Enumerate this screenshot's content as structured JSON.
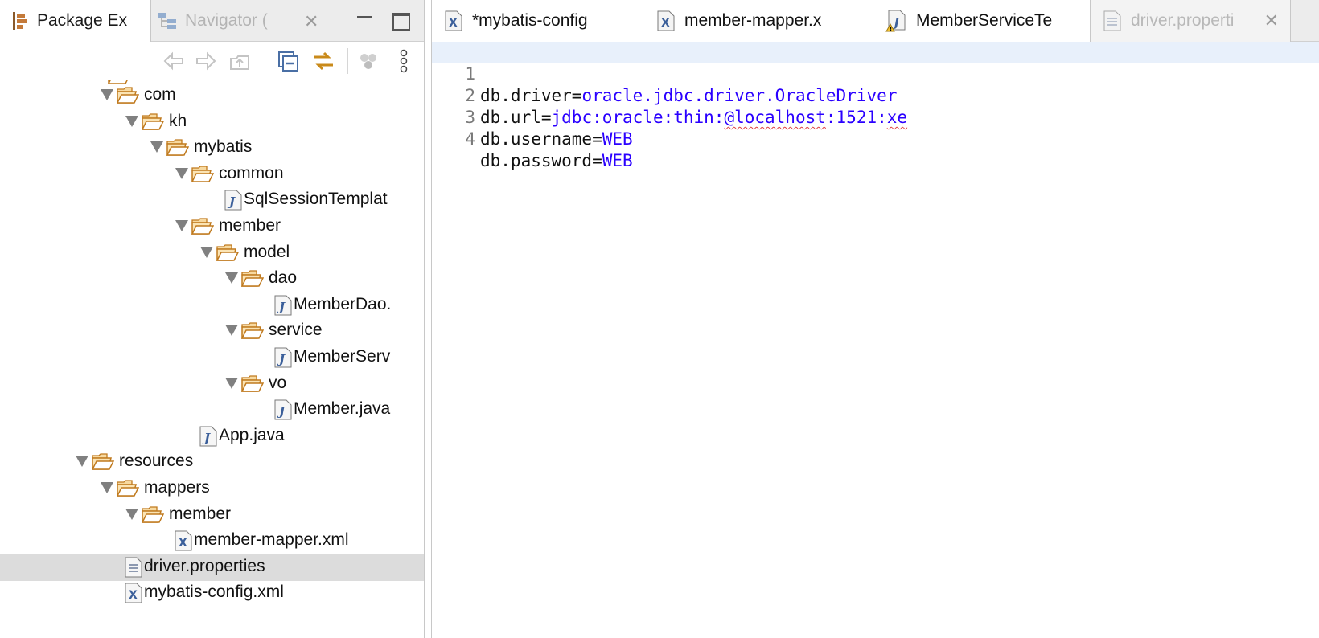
{
  "left_panel": {
    "tabs": [
      {
        "label": "Package Ex",
        "icon": "package-explorer-icon",
        "active": true
      },
      {
        "label": "Navigator (",
        "icon": "navigator-icon",
        "active": false
      }
    ],
    "tree": [
      {
        "label": "com",
        "type": "folder",
        "depth": 1,
        "expanded": true
      },
      {
        "label": "kh",
        "type": "folder",
        "depth": 2,
        "expanded": true
      },
      {
        "label": "mybatis",
        "type": "folder",
        "depth": 3,
        "expanded": true
      },
      {
        "label": "common",
        "type": "folder",
        "depth": 4,
        "expanded": true
      },
      {
        "label": "SqlSessionTemplat",
        "type": "java",
        "depth": 5
      },
      {
        "label": "member",
        "type": "folder",
        "depth": 4,
        "expanded": true
      },
      {
        "label": "model",
        "type": "folder",
        "depth": 5,
        "expanded": true
      },
      {
        "label": "dao",
        "type": "folder",
        "depth": 6,
        "expanded": true
      },
      {
        "label": "MemberDao.",
        "type": "java",
        "depth": 7
      },
      {
        "label": "service",
        "type": "folder",
        "depth": 6,
        "expanded": true
      },
      {
        "label": "MemberServ",
        "type": "java",
        "depth": 7
      },
      {
        "label": "vo",
        "type": "folder",
        "depth": 6,
        "expanded": true
      },
      {
        "label": "Member.java",
        "type": "java",
        "depth": 7
      },
      {
        "label": "App.java",
        "type": "java",
        "depth": 4
      },
      {
        "label": "resources",
        "type": "folder",
        "depth": 0,
        "expanded": true
      },
      {
        "label": "mappers",
        "type": "folder",
        "depth": 1,
        "expanded": true
      },
      {
        "label": "member",
        "type": "folder",
        "depth": 2,
        "expanded": true
      },
      {
        "label": "member-mapper.xml",
        "type": "xml",
        "depth": 3
      },
      {
        "label": "driver.properties",
        "type": "properties",
        "depth": 1,
        "selected": true
      },
      {
        "label": "mybatis-config.xml",
        "type": "xml",
        "depth": 1
      }
    ]
  },
  "editor": {
    "tabs": [
      {
        "label": "*mybatis-config",
        "icon": "xml-file-icon",
        "state": "active"
      },
      {
        "label": "member-mapper.x",
        "icon": "xml-file-icon",
        "state": "active"
      },
      {
        "label": "MemberServiceTe",
        "icon": "java-warning-file-icon",
        "state": "active"
      },
      {
        "label": "driver.properti",
        "icon": "properties-file-icon",
        "state": "dim"
      }
    ],
    "lines": [
      {
        "num": "1",
        "key": "db.driver=",
        "value": "oracle.jdbc.driver.OracleDriver"
      },
      {
        "num": "2",
        "key": "db.url=",
        "value_parts": [
          "jdbc:oracle:thin:",
          "@localhost",
          ":1521:",
          "xe"
        ]
      },
      {
        "num": "3",
        "key": "db.username=",
        "value": "WEB"
      },
      {
        "num": "4",
        "key": "db.password=",
        "value": "WEB"
      }
    ]
  },
  "colors": {
    "value_blue": "#2a00ff",
    "folder_orange": "#e3a040",
    "selection_gray": "#dcdcdc",
    "current_line": "#e8f0fb"
  }
}
